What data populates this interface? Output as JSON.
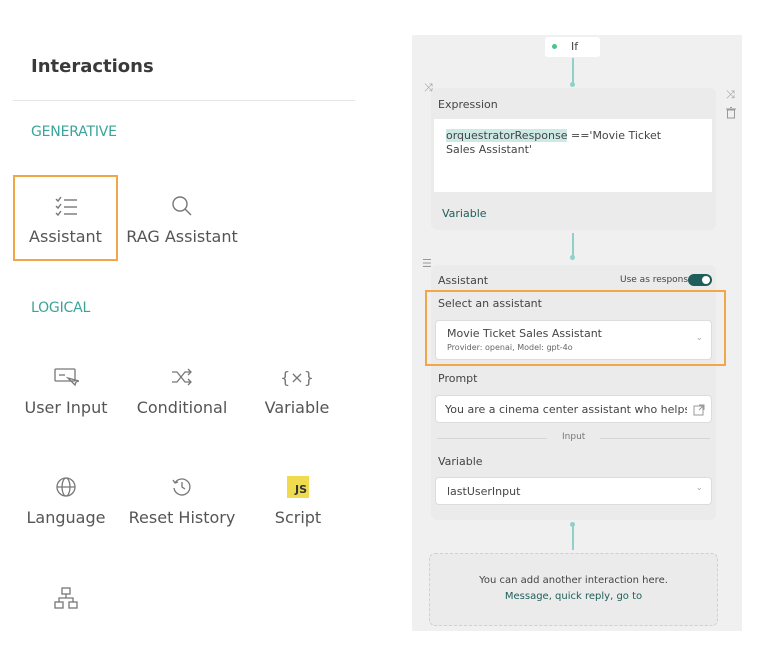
{
  "left": {
    "title": "Interactions",
    "generative_label": "GENERATIVE",
    "logical_label": "LOGICAL",
    "tiles": {
      "assistant": "Assistant",
      "rag": "RAG Assistant",
      "user_input": "User Input",
      "conditional": "Conditional",
      "variable": "Variable",
      "language": "Language",
      "reset_history": "Reset History",
      "script": "Script",
      "script_badge": "JS"
    }
  },
  "flow": {
    "if_label": "If",
    "expression": {
      "label": "Expression",
      "var_highlight": "orquestratorResponse",
      "text_rest": " =='Movie Ticket Sales Assistant'",
      "footer": "Variable"
    },
    "assistant": {
      "label": "Assistant",
      "use_as_response": "Use as response",
      "select_label": "Select an assistant",
      "selected_name": "Movie Ticket Sales Assistant",
      "selected_meta": "Provider: openai, Model: gpt-4o",
      "prompt_label": "Prompt",
      "prompt_value": "You are a cinema center assistant who helps a user",
      "divider_label": "Input",
      "variable_label": "Variable",
      "variable_value": "lastUserInput"
    },
    "add_hint": {
      "line1": "You can add another interaction here.",
      "line2": "Message, quick reply, go to"
    }
  },
  "colors": {
    "accent": "#3aa49a",
    "selection": "#f2a64a",
    "toggle": "#1f5e5a",
    "connector": "#8fd0c8",
    "js_badge": "#f0db4f"
  }
}
